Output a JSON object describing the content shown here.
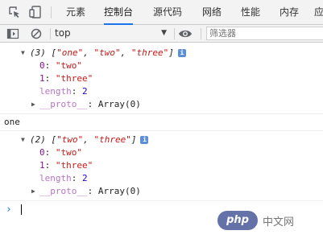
{
  "tabs": [
    "元素",
    "控制台",
    "源代码",
    "网络",
    "性能",
    "内存",
    "应"
  ],
  "active_tab": "控制台",
  "toolbar": {
    "context_value": "top",
    "filter_placeholder": "筛选器"
  },
  "console": {
    "first_array": {
      "summary_count": "(3)",
      "summary_items": [
        "\"one\"",
        "\"two\"",
        "\"three\""
      ],
      "entries": [
        {
          "key": "0",
          "value": "\"two\""
        },
        {
          "key": "1",
          "value": "\"three\""
        }
      ],
      "length_key": "length",
      "length_value": "2",
      "proto_key": "__proto__",
      "proto_value": "Array(0)"
    },
    "plain_log": "one",
    "second_array": {
      "summary_count": "(2)",
      "summary_items": [
        "\"two\"",
        "\"three\""
      ],
      "entries": [
        {
          "key": "0",
          "value": "\"two\""
        },
        {
          "key": "1",
          "value": "\"three\""
        }
      ],
      "length_key": "length",
      "length_value": "2",
      "proto_key": "__proto__",
      "proto_value": "Array(0)"
    }
  },
  "watermark": {
    "logo_text": "php",
    "site_text": "中文网"
  },
  "colors": {
    "accent": "#1a73e8",
    "string": "#c41a16",
    "key": "#881391",
    "number": "#1c00cf"
  }
}
